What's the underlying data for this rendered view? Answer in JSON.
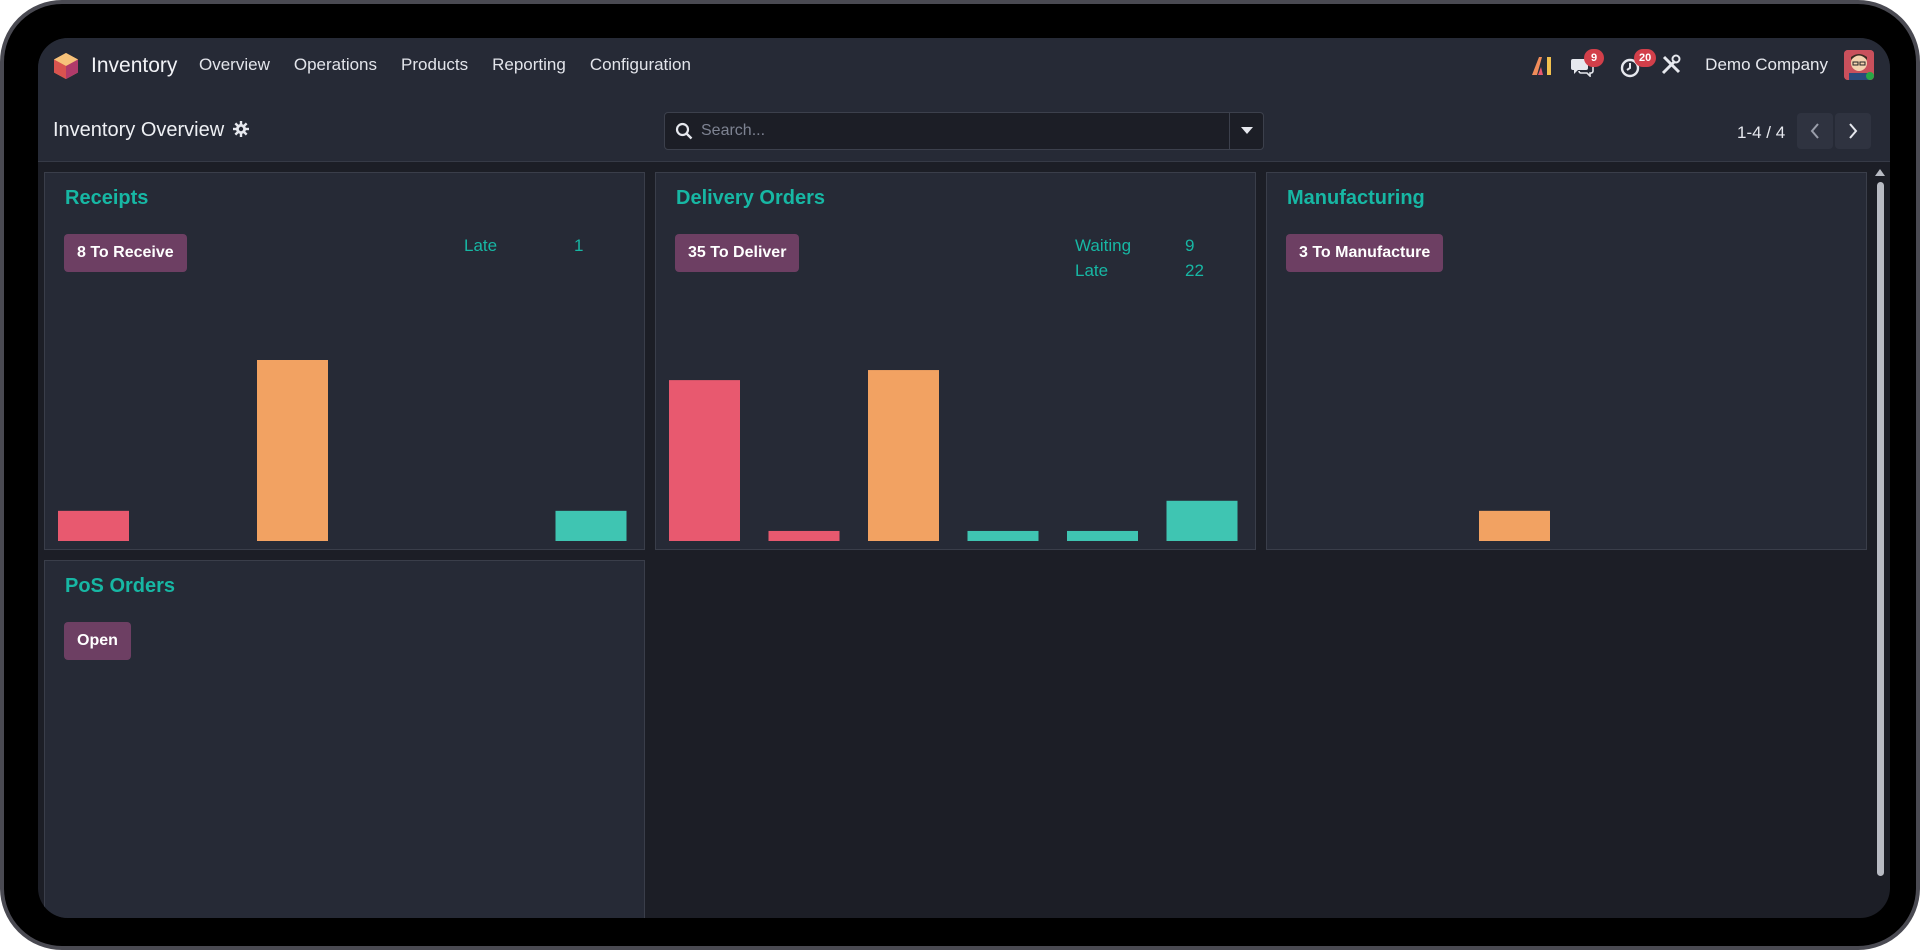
{
  "navbar": {
    "app_name": "Inventory",
    "menu": [
      "Overview",
      "Operations",
      "Products",
      "Reporting",
      "Configuration"
    ],
    "messages_badge": "9",
    "activities_badge": "20",
    "company": "Demo Company"
  },
  "control": {
    "title": "Inventory Overview",
    "search_placeholder": "Search...",
    "pager": "1-4 / 4"
  },
  "colors": {
    "red": "#e8596f",
    "orange": "#f2a262",
    "teal": "#3fc5b2",
    "accent": "#17b7a4",
    "button": "#6d3f63"
  },
  "cards": {
    "receipts": {
      "title": "Receipts",
      "button": "8 To Receive",
      "stats": [
        {
          "label": "Late",
          "value": "1"
        }
      ]
    },
    "delivery": {
      "title": "Delivery Orders",
      "button": "35 To Deliver",
      "stats": [
        {
          "label": "Waiting",
          "value": "9"
        },
        {
          "label": "Late",
          "value": "22"
        }
      ]
    },
    "manufacturing": {
      "title": "Manufacturing",
      "button": "3 To Manufacture"
    },
    "pos": {
      "title": "PoS Orders",
      "button": "Open"
    }
  },
  "chart_data": [
    {
      "type": "bar",
      "series_colors": [
        "red",
        "red",
        "orange",
        "teal",
        "teal",
        "teal"
      ],
      "values": [
        3,
        0,
        18,
        0,
        0,
        3
      ]
    },
    {
      "type": "bar",
      "series_colors": [
        "red",
        "red",
        "orange",
        "teal",
        "teal",
        "teal"
      ],
      "values": [
        16,
        1,
        17,
        1,
        1,
        4
      ]
    },
    {
      "type": "bar",
      "series_colors": [
        "red",
        "red",
        "orange",
        "teal",
        "teal",
        "teal"
      ],
      "values": [
        0,
        0,
        3,
        0,
        0,
        0
      ]
    }
  ]
}
